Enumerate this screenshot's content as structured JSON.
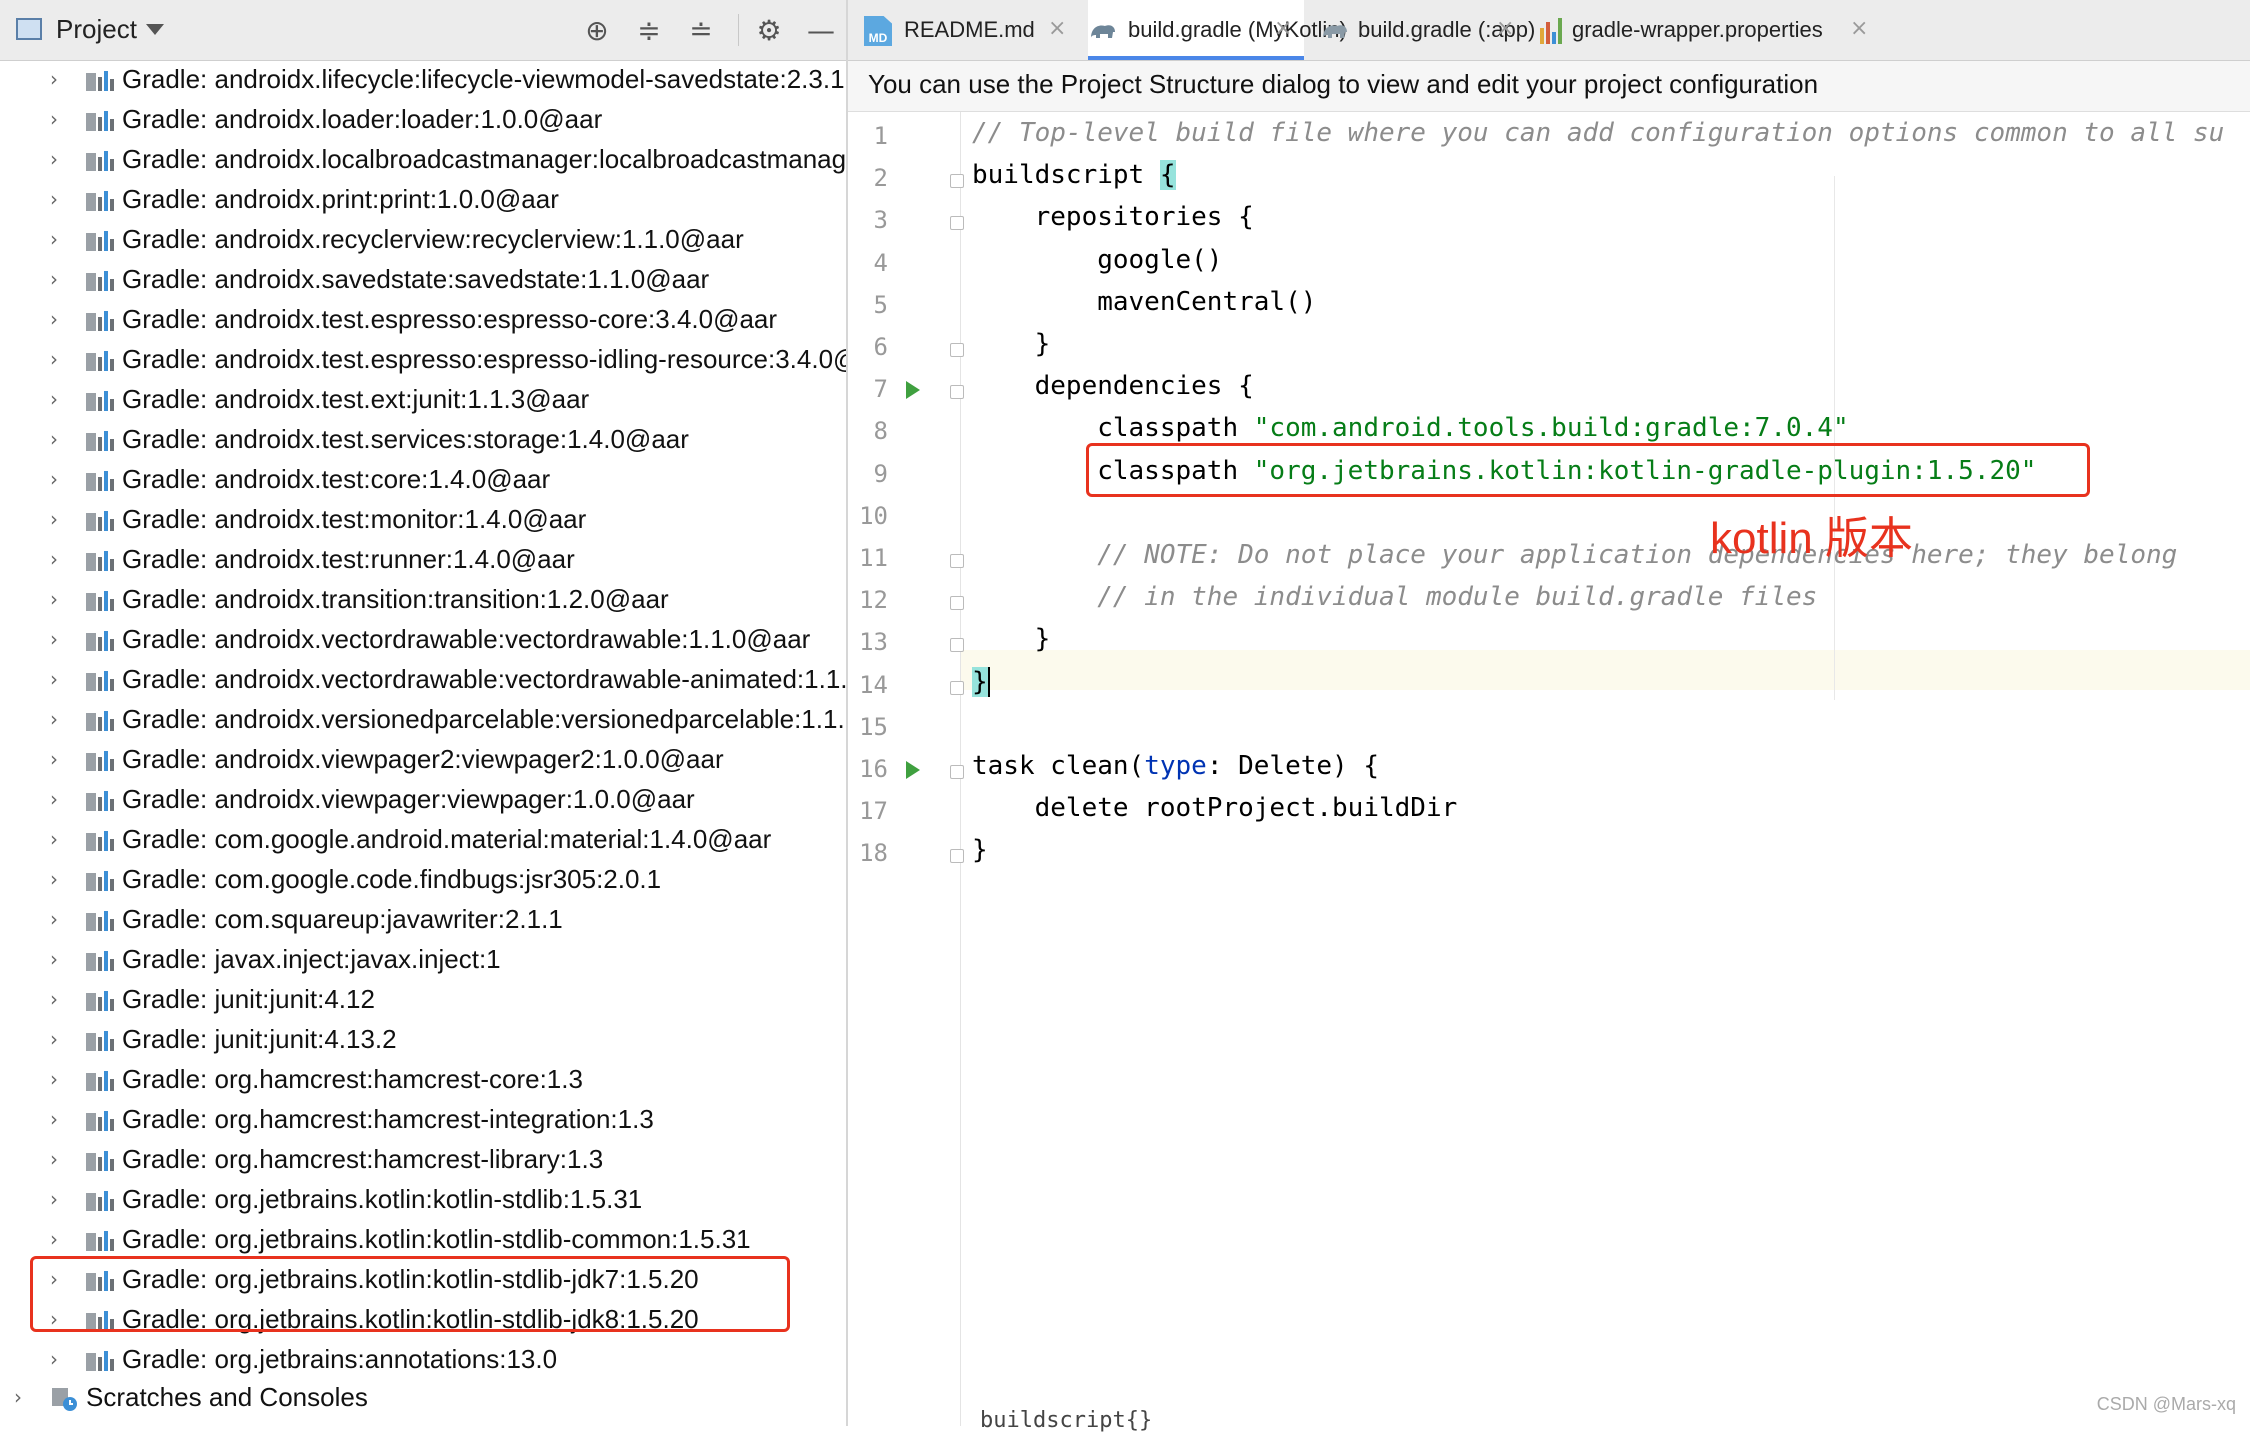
{
  "project_panel": {
    "title": "Project",
    "tree_items": [
      "Gradle: androidx.lifecycle:lifecycle-viewmodel-savedstate:2.3.1",
      "Gradle: androidx.loader:loader:1.0.0@aar",
      "Gradle: androidx.localbroadcastmanager:localbroadcastmanag",
      "Gradle: androidx.print:print:1.0.0@aar",
      "Gradle: androidx.recyclerview:recyclerview:1.1.0@aar",
      "Gradle: androidx.savedstate:savedstate:1.1.0@aar",
      "Gradle: androidx.test.espresso:espresso-core:3.4.0@aar",
      "Gradle: androidx.test.espresso:espresso-idling-resource:3.4.0@",
      "Gradle: androidx.test.ext:junit:1.1.3@aar",
      "Gradle: androidx.test.services:storage:1.4.0@aar",
      "Gradle: androidx.test:core:1.4.0@aar",
      "Gradle: androidx.test:monitor:1.4.0@aar",
      "Gradle: androidx.test:runner:1.4.0@aar",
      "Gradle: androidx.transition:transition:1.2.0@aar",
      "Gradle: androidx.vectordrawable:vectordrawable:1.1.0@aar",
      "Gradle: androidx.vectordrawable:vectordrawable-animated:1.1.",
      "Gradle: androidx.versionedparcelable:versionedparcelable:1.1.",
      "Gradle: androidx.viewpager2:viewpager2:1.0.0@aar",
      "Gradle: androidx.viewpager:viewpager:1.0.0@aar",
      "Gradle: com.google.android.material:material:1.4.0@aar",
      "Gradle: com.google.code.findbugs:jsr305:2.0.1",
      "Gradle: com.squareup:javawriter:2.1.1",
      "Gradle: javax.inject:javax.inject:1",
      "Gradle: junit:junit:4.12",
      "Gradle: junit:junit:4.13.2",
      "Gradle: org.hamcrest:hamcrest-core:1.3",
      "Gradle: org.hamcrest:hamcrest-integration:1.3",
      "Gradle: org.hamcrest:hamcrest-library:1.3",
      "Gradle: org.jetbrains.kotlin:kotlin-stdlib:1.5.31",
      "Gradle: org.jetbrains.kotlin:kotlin-stdlib-common:1.5.31",
      "Gradle: org.jetbrains.kotlin:kotlin-stdlib-jdk7:1.5.20",
      "Gradle: org.jetbrains.kotlin:kotlin-stdlib-jdk8:1.5.20",
      "Gradle: org.jetbrains:annotations:13.0"
    ],
    "scratches_label": "Scratches and Consoles"
  },
  "tabs": [
    {
      "label": "README.md",
      "icon": "markdown-file-icon",
      "icon_text": "MD"
    },
    {
      "label": "build.gradle (MyKotlin)",
      "icon": "gradle-elephant-icon"
    },
    {
      "label": "build.gradle (:app)",
      "icon": "gradle-elephant-icon"
    },
    {
      "label": "gradle-wrapper.properties",
      "icon": "properties-file-icon"
    }
  ],
  "notice": "You can use the Project Structure dialog to view and edit your project configuration",
  "code": {
    "line_numbers": [
      "1",
      "2",
      "3",
      "4",
      "5",
      "6",
      "7",
      "8",
      "9",
      "10",
      "11",
      "12",
      "13",
      "14",
      "15",
      "16",
      "17",
      "18"
    ],
    "l1": "// Top-level build file where you can add configuration options common to all su",
    "l2_a": "buildscript ",
    "l2_b": "{",
    "l3": "    repositories {",
    "l4": "        google()",
    "l5": "        mavenCentral()",
    "l6": "    }",
    "l7": "    dependencies {",
    "l8_a": "        classpath ",
    "l8_b": "\"com.android.tools.build:gradle:7.0.4\"",
    "l9_a": "        classpath ",
    "l9_b": "\"org.jetbrains.kotlin:kotlin-gradle-plugin:1.5.20\"",
    "l11": "        // NOTE: Do not place your application dependencies here; they belong",
    "l12": "        // in the individual module build.gradle files",
    "l13": "    }",
    "l14": "}",
    "l16_a": "task clean(",
    "l16_b": "type",
    "l16_c": ": Delete) {",
    "l17": "    delete rootProject.buildDir",
    "l18": "}"
  },
  "annotation": "kotlin 版本",
  "breadcrumb": "buildscript{}",
  "watermark": "CSDN @Mars-xq",
  "colors": {
    "highlight_box": "#e8321e",
    "string": "#067d17",
    "accent": "#4a86e8",
    "run_icon": "#3fa03f"
  }
}
